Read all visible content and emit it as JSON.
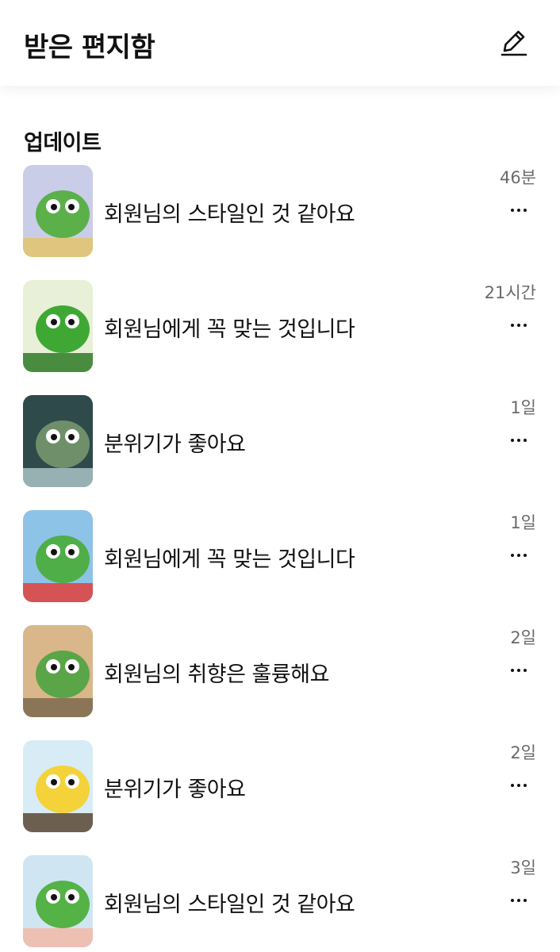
{
  "header": {
    "title": "받은 편지함",
    "compose_icon": "pencil-edit-icon"
  },
  "section": {
    "title": "업데이트"
  },
  "updates": [
    {
      "message": "회원님의 스타일인 것 같아요",
      "time": "46분",
      "thumb_colors": [
        "#c9cde8",
        "#5bb04a",
        "#e3c36a"
      ]
    },
    {
      "message": "회원님에게 꼭 맞는 것입니다",
      "time": "21시간",
      "thumb_colors": [
        "#e8f0d8",
        "#3fa834",
        "#2d7a26"
      ]
    },
    {
      "message": "분위기가 좋아요",
      "time": "1일",
      "thumb_colors": [
        "#2f4a4a",
        "#6e8f6a",
        "#a9c2c6"
      ]
    },
    {
      "message": "회원님에게 꼭 맞는 것입니다",
      "time": "1일",
      "thumb_colors": [
        "#8ec3e8",
        "#4fae47",
        "#e2403a"
      ]
    },
    {
      "message": "회원님의 취향은 훌륭해요",
      "time": "2일",
      "thumb_colors": [
        "#d9b78a",
        "#5aa548",
        "#7d6a4e"
      ]
    },
    {
      "message": "분위기가 좋아요",
      "time": "2일",
      "thumb_colors": [
        "#d8ecf5",
        "#f4d23a",
        "#5a4632"
      ]
    },
    {
      "message": "회원님의 스타일인 것 같아요",
      "time": "3일",
      "thumb_colors": [
        "#cfe6f2",
        "#55b247",
        "#f2b8a8"
      ]
    }
  ],
  "more_icon": "more-horizontal-icon"
}
